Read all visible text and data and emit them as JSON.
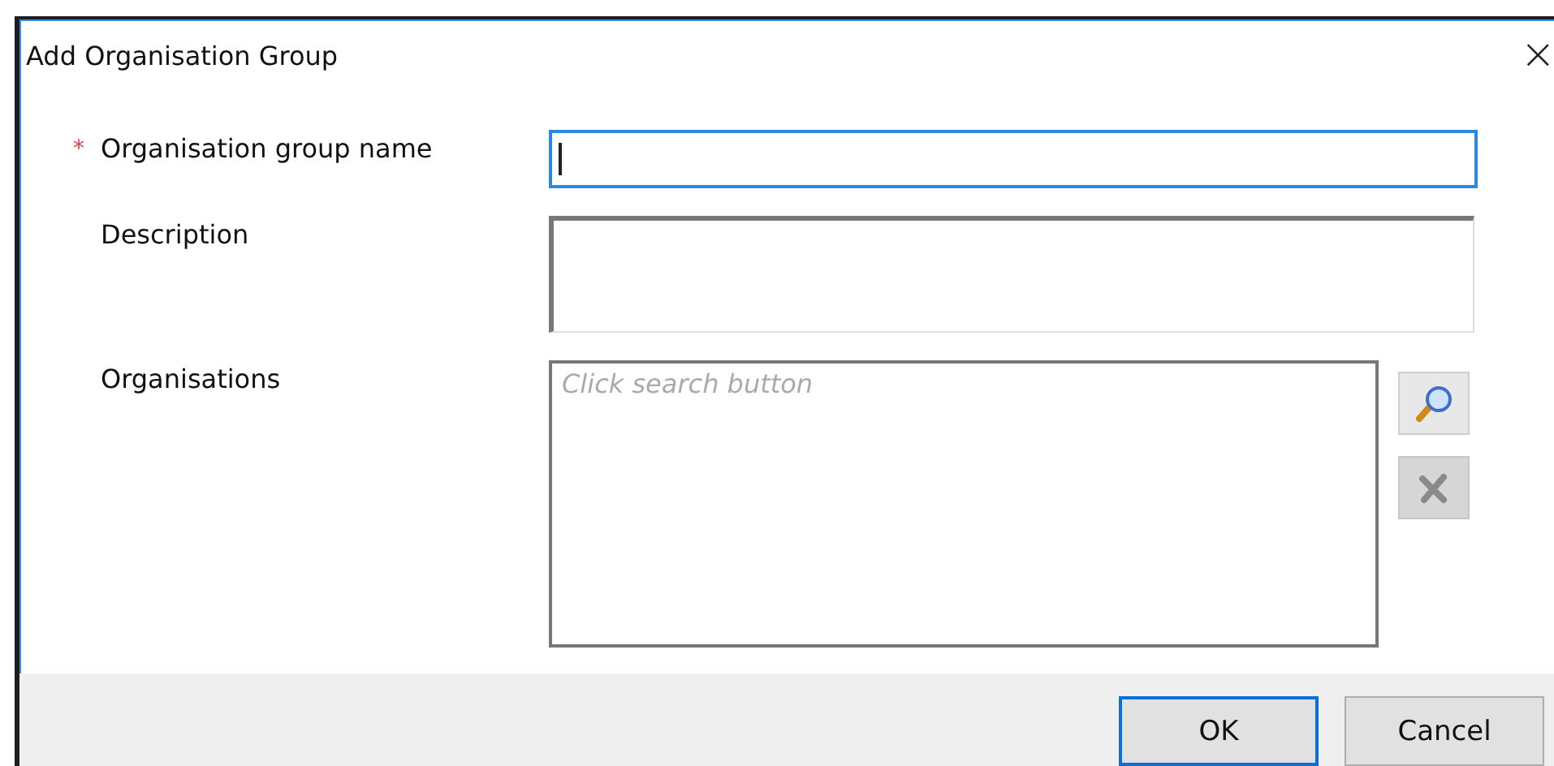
{
  "window": {
    "title": "Add Organisation Group",
    "close": "×"
  },
  "fields": [
    {
      "kind": "text",
      "label": "Organisation group name",
      "required": true,
      "required_mark": "*",
      "focused": true
    },
    {
      "kind": "multiline",
      "label": "Description",
      "required": false,
      "focused": false
    },
    {
      "kind": "list",
      "label": "Organisations",
      "required": false,
      "focused": false,
      "placeholder": "Click search button",
      "tools": [
        {
          "kind": "search",
          "disabled": false
        },
        {
          "kind": "remove",
          "disabled": true
        }
      ]
    }
  ],
  "buttons": [
    {
      "label": "OK",
      "default": true
    },
    {
      "label": "Cancel",
      "default": false
    }
  ]
}
